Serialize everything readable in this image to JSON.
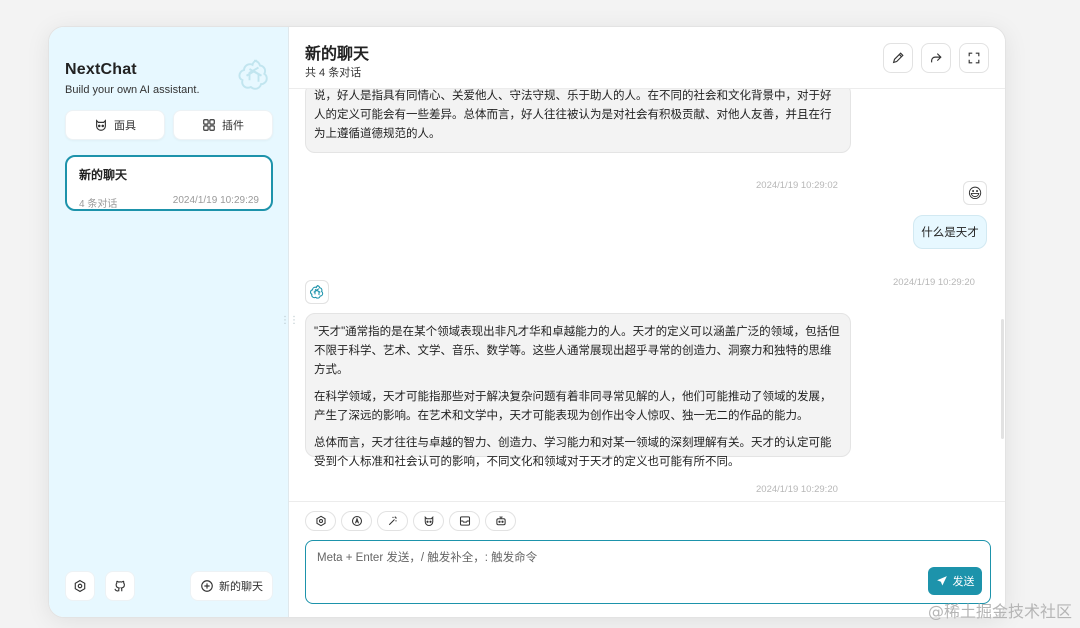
{
  "sidebar": {
    "title": "NextChat",
    "subtitle": "Build your own AI assistant.",
    "mask_label": "面具",
    "plugin_label": "插件",
    "sessions": [
      {
        "title": "新的聊天",
        "count": "4 条对话",
        "time": "2024/1/19 10:29:29"
      }
    ],
    "new_chat_label": "新的聊天"
  },
  "header": {
    "title": "新的聊天",
    "subtitle": "共 4 条对话"
  },
  "messages": {
    "m1_text": "说，好人是指具有同情心、关爱他人、守法守规、乐于助人的人。在不同的社会和文化背景中，对于好人的定义可能会有一些差异。总体而言，好人往往被认为是对社会有积极贡献、对他人友善，并且在行为上遵循道德规范的人。",
    "m1_time": "2024/1/19 10:29:02",
    "m2_text": "什么是天才",
    "m2_time": "2024/1/19 10:29:20",
    "m2_avatar": "😃",
    "m3_p1": "\"天才\"通常指的是在某个领域表现出非凡才华和卓越能力的人。天才的定义可以涵盖广泛的领域，包括但不限于科学、艺术、文学、音乐、数学等。这些人通常展现出超乎寻常的创造力、洞察力和独特的思维方式。",
    "m3_p2": "在科学领域，天才可能指那些对于解决复杂问题有着非同寻常见解的人，他们可能推动了领域的发展，产生了深远的影响。在艺术和文学中，天才可能表现为创作出令人惊叹、独一无二的作品的能力。",
    "m3_p3": "总体而言，天才往往与卓越的智力、创造力、学习能力和对某一领域的深刻理解有关。天才的认定可能受到个人标准和社会认可的影响，不同文化和领域对于天才的定义也可能有所不同。",
    "m3_time": "2024/1/19 10:29:20"
  },
  "input": {
    "placeholder": "Meta + Enter 发送，/ 触发补全，: 触发命令",
    "send_label": "发送"
  },
  "watermark": "@稀土掘金技术社区",
  "colors": {
    "accent": "#1d93ab",
    "sidebar_bg": "#e7f8ff",
    "bubble_bg": "#f3f3f3"
  },
  "icons": {
    "brand": "openai-logo-icon",
    "mask": "mask-icon",
    "plugin": "grid-icon",
    "settings": "settings-icon",
    "github": "github-icon",
    "add": "add-circle-icon",
    "edit": "edit-icon",
    "share": "share-icon",
    "fullscreen": "fullscreen-icon",
    "send": "send-icon"
  }
}
